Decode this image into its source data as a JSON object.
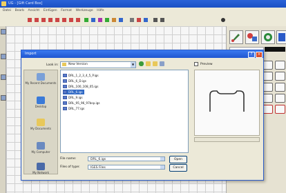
{
  "app": {
    "title": "UG - [Gift Card Box]"
  },
  "menubar": {
    "items": [
      "Datei",
      "Bearb",
      "Ansicht",
      "Einfügen",
      "Format",
      "Werkzeuge",
      "Hilfe"
    ]
  },
  "dialog": {
    "title": "Import",
    "look_in_label": "Look in:",
    "look_in_value": "New Version",
    "places": [
      {
        "label": "My Recent Documents",
        "icon": "recent-documents-icon"
      },
      {
        "label": "Desktop",
        "icon": "desktop-icon"
      },
      {
        "label": "My Documents",
        "icon": "my-documents-icon"
      },
      {
        "label": "My Computer",
        "icon": "my-computer-icon"
      },
      {
        "label": "My Network",
        "icon": "network-icon"
      }
    ],
    "files": [
      {
        "name": "DRL_1_2_3_4_5_P.igs",
        "selected": false
      },
      {
        "name": "DRL_6_D.igs",
        "selected": false
      },
      {
        "name": "DRL_100_108_05.igs",
        "selected": false
      },
      {
        "name": "DRL_6.igs",
        "selected": true
      },
      {
        "name": "DRL_9.igs",
        "selected": false
      },
      {
        "name": "DRL_95_96_97bsp.igs",
        "selected": false
      },
      {
        "name": "DRL_77.igs",
        "selected": false
      }
    ],
    "preview_label": "Preview",
    "file_name_label": "File name:",
    "file_name_value": "DRL_6.igs",
    "file_type_label": "Files of type:",
    "file_type_value": "IGES Files",
    "open_button": "Open",
    "cancel_button": "Cancel"
  },
  "colors": {
    "titlebar": "#1f55d0",
    "selection": "#316ac5",
    "dialog_bg": "#ece9d8",
    "close": "#d8502e"
  }
}
